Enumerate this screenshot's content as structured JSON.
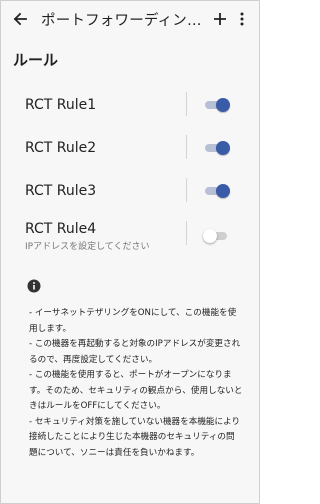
{
  "appbar": {
    "title": "ポートフォワーディン…"
  },
  "section": {
    "title": "ルール"
  },
  "rules": [
    {
      "label": "RCT Rule1",
      "sub": "",
      "enabled": true
    },
    {
      "label": "RCT Rule2",
      "sub": "",
      "enabled": true
    },
    {
      "label": "RCT Rule3",
      "sub": "",
      "enabled": true
    },
    {
      "label": "RCT Rule4",
      "sub": "IPアドレスを設定してください",
      "enabled": false
    }
  ],
  "notes": [
    "- イーサネットテザリングをONにして、この機能を使用します。",
    "- この機器を再起動すると対象のIPアドレスが変更されるので、再度設定してください。",
    "- この機能を使用すると、ポートがオープンになります。そのため、セキュリティの観点から、使用しないときはルールをOFFにしてください。",
    "- セキュリティ対策を施していない機器を本機能により接続したことにより生じた本機器のセキュリティの問題について、ソニーは責任を負いかねます。"
  ],
  "colors": {
    "accent": "#3a5ba8",
    "track_on": "#b8c0d6",
    "track_off": "#cfcfcf"
  },
  "icons": {
    "back": "arrow-back-icon",
    "add": "plus-icon",
    "more": "more-vert-icon",
    "info": "info-icon"
  }
}
